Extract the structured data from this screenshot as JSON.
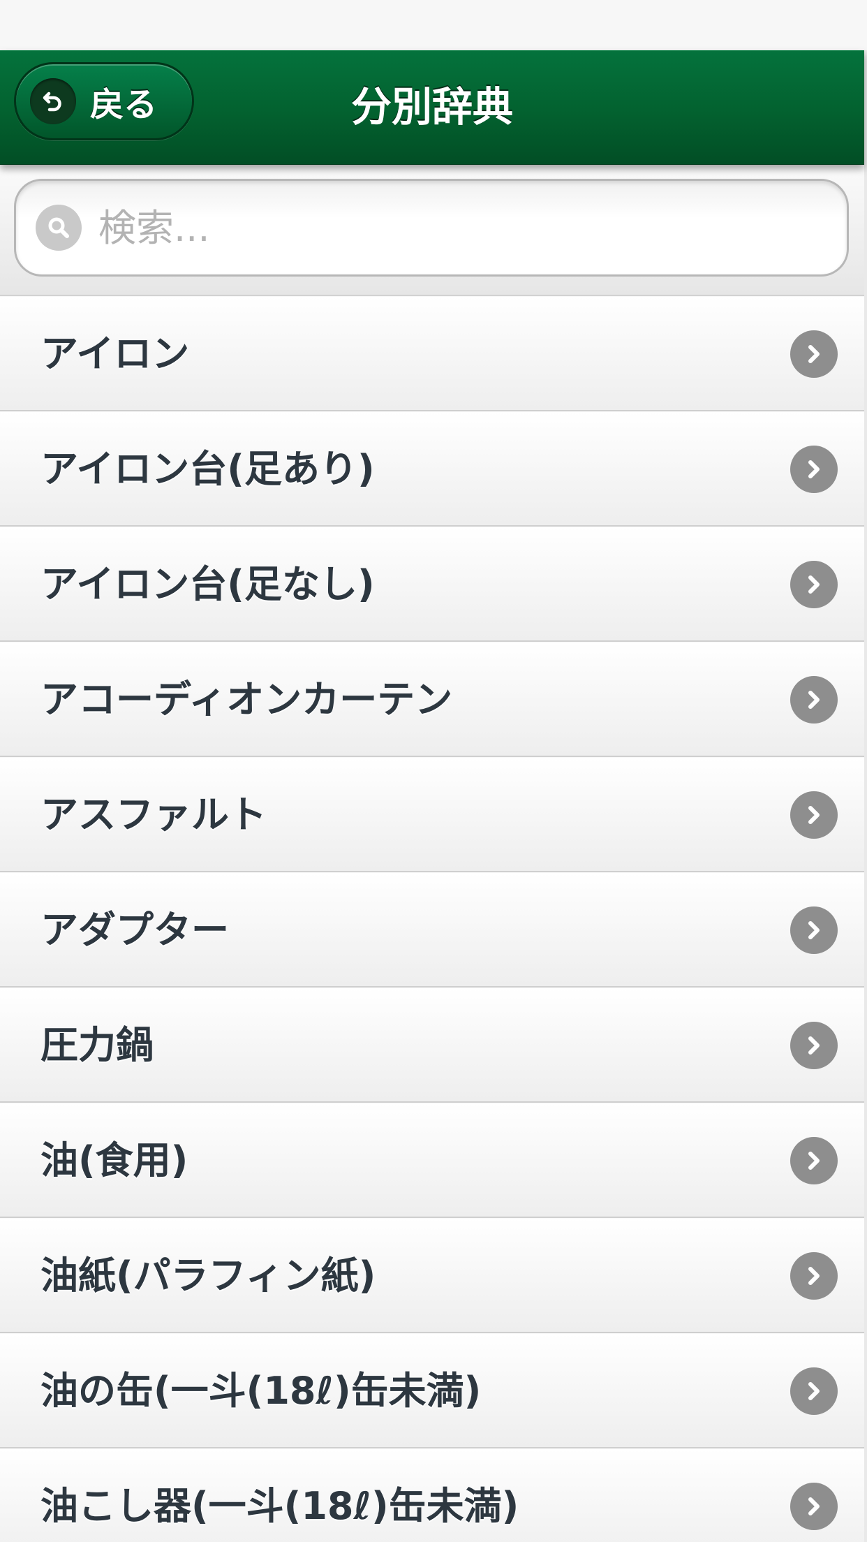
{
  "header": {
    "back_label": "戻る",
    "back_icon": "undo-arrow-icon",
    "title": "分別辞典",
    "background_color": "#03612f"
  },
  "search": {
    "placeholder": "検索...",
    "value": "",
    "icon": "search-icon"
  },
  "list": {
    "chevron_icon": "chevron-right-icon",
    "items": [
      {
        "label": "アイロン"
      },
      {
        "label": "アイロン台(足あり)"
      },
      {
        "label": "アイロン台(足なし)"
      },
      {
        "label": "アコーディオンカーテン"
      },
      {
        "label": "アスファルト"
      },
      {
        "label": "アダプター"
      },
      {
        "label": "圧力鍋"
      },
      {
        "label": "油(食用)"
      },
      {
        "label": "油紙(パラフィン紙)"
      },
      {
        "label": "油の缶(一斗(18ℓ)缶未満)"
      },
      {
        "label": "油こし器(一斗(18ℓ)缶未満)"
      }
    ]
  }
}
